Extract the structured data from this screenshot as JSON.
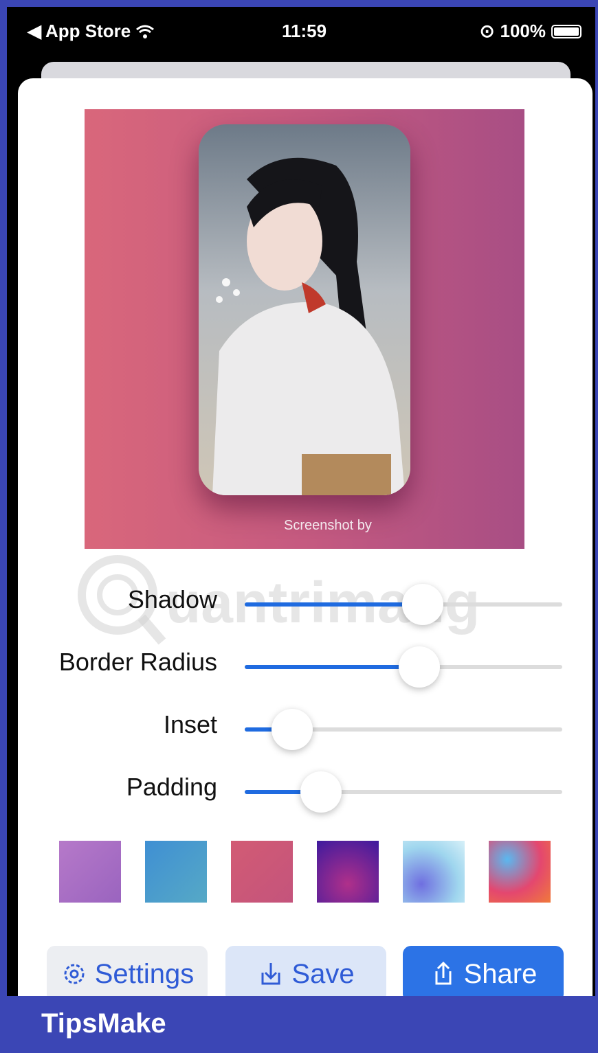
{
  "status_bar": {
    "back_label": "App Store",
    "time": "11:59",
    "battery": "100%"
  },
  "preview": {
    "caption": "Screenshot by"
  },
  "controls": [
    {
      "label": "Shadow",
      "value": 0.56
    },
    {
      "label": "Border Radius",
      "value": 0.55
    },
    {
      "label": "Inset",
      "value": 0.15
    },
    {
      "label": "Padding",
      "value": 0.24
    }
  ],
  "colors": {
    "accent": "#1f6be0",
    "swatches": [
      "#a76ec6",
      "#4a9bd0",
      "#cc5a78",
      "#8a2aa6",
      "#8ec6ea",
      "#e44c68"
    ]
  },
  "buttons": {
    "settings": "Settings",
    "save": "Save",
    "share": "Share"
  },
  "footer": {
    "brand": "TipsMake"
  }
}
